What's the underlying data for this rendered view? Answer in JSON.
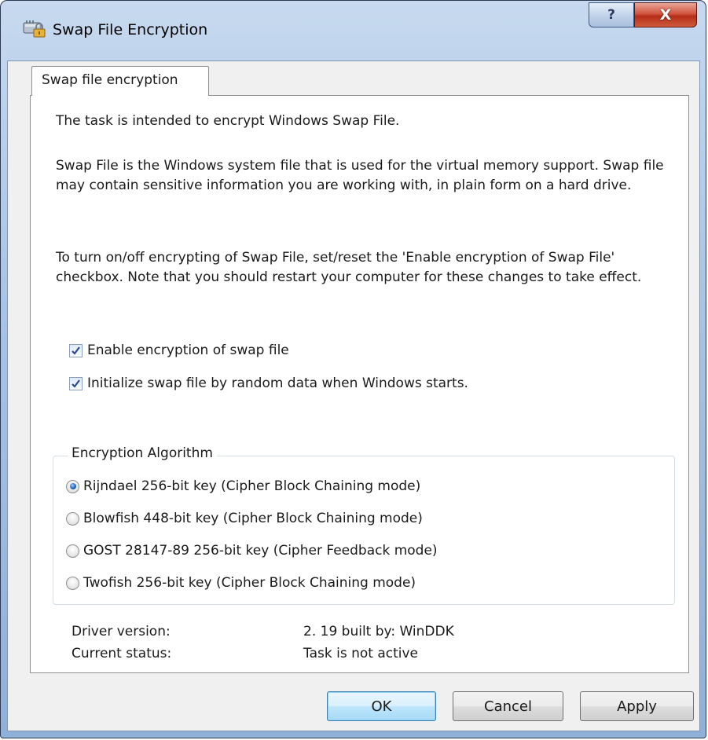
{
  "window": {
    "title": "Swap File Encryption",
    "help_label": "?",
    "close_label": "X"
  },
  "tab": {
    "label": "Swap file encryption"
  },
  "description": {
    "p1": "The task is intended to encrypt Windows Swap File.",
    "p2": "Swap File is the Windows system file that is used for the virtual memory support. Swap file may contain sensitive information you are working with, in plain form on a hard drive.",
    "p3": "To turn on/off encrypting of Swap File, set/reset the 'Enable encryption of Swap File' checkbox. Note that you should restart your computer for these changes to take effect."
  },
  "options": [
    {
      "label": "Enable encryption of swap file",
      "checked": true
    },
    {
      "label": "Initialize swap file by random data when Windows starts.",
      "checked": true
    }
  ],
  "algorithm": {
    "legend": "Encryption Algorithm",
    "selected": 0,
    "items": [
      {
        "label": "Rijndael 256-bit key (Cipher Block Chaining mode)"
      },
      {
        "label": "Blowfish 448-bit key (Cipher Block Chaining mode)"
      },
      {
        "label": "GOST 28147-89 256-bit key (Cipher Feedback mode)"
      },
      {
        "label": "Twofish 256-bit key (Cipher Block Chaining mode)"
      }
    ]
  },
  "info": {
    "driver_label": "Driver version:",
    "driver_value": "2. 19 built by: WinDDK",
    "status_label": "Current status:",
    "status_value": "Task is not active"
  },
  "buttons": {
    "ok": "OK",
    "cancel": "Cancel",
    "apply": "Apply"
  },
  "colors": {
    "titlebar": "#a9c4e4",
    "close": "#c8432b",
    "default_button": "#bee6fd",
    "radio_selected": "#1a5fb4",
    "checkmark": "#2a4a8a"
  }
}
